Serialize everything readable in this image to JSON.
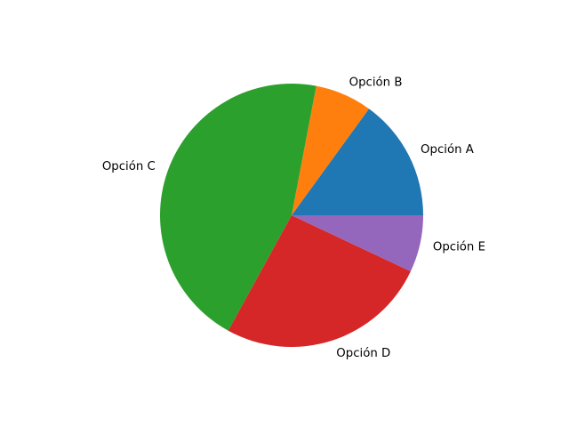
{
  "chart_data": {
    "type": "pie",
    "categories": [
      "Opción A",
      "Opción B",
      "Opción C",
      "Opción D",
      "Opción E"
    ],
    "values": [
      15,
      7,
      45,
      26,
      7
    ],
    "colors": [
      "#1f77b4",
      "#ff7f0e",
      "#2ca02c",
      "#d62728",
      "#9467bd"
    ],
    "start_angle_deg": 0,
    "direction": "counterclockwise"
  }
}
